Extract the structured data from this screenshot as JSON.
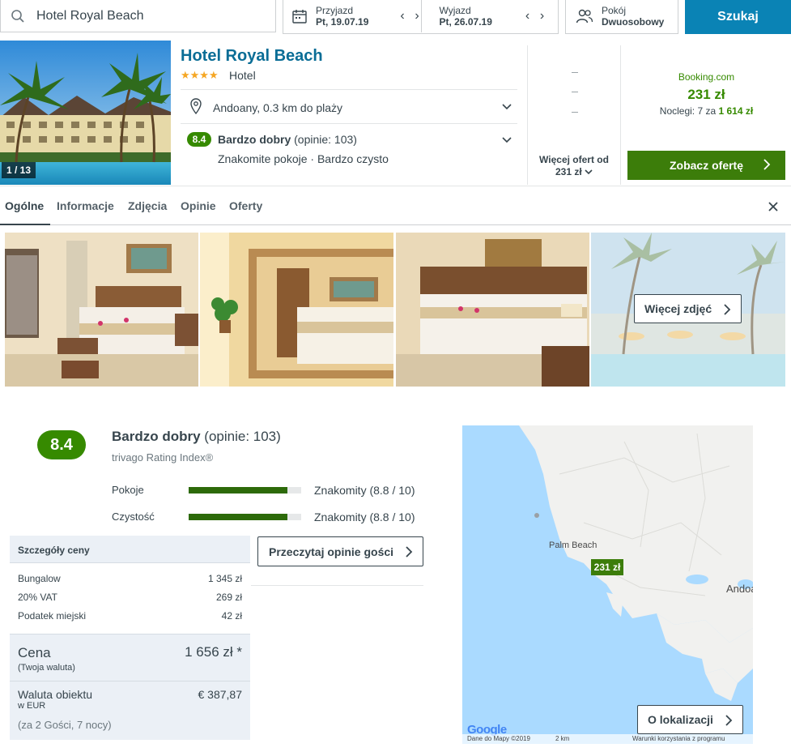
{
  "search": {
    "query": "Hotel Royal Beach"
  },
  "dates": {
    "checkin_label": "Przyjazd",
    "checkin_value": "Pt, 19.07.19",
    "checkout_label": "Wyjazd",
    "checkout_value": "Pt, 26.07.19"
  },
  "room": {
    "label": "Pokój",
    "value": "Dwuosobowy"
  },
  "search_button": "Szukaj",
  "hotel": {
    "name": "Hotel Royal Beach",
    "stars": "★★★★",
    "star_count": 4,
    "type": "Hotel",
    "photo_counter": "1 / 13",
    "location": "Andoany, 0.3 km do plaży",
    "rating": "8.4",
    "rating_label": "Bardzo dobry",
    "rating_count": "(opinie: 103)",
    "highlights": "Znakomite pokoje · Bardzo czysto"
  },
  "offers": {
    "more_offers_line1": "Więcej ofert od",
    "more_offers_line2": "231 zł",
    "provider": "Booking.com",
    "price": "231 zł",
    "nights_text": "Noclegi: 7 za",
    "nights_total": "1 614 zł",
    "cta": "Zobacz ofertę"
  },
  "tabs": [
    "Ogólne",
    "Informacje",
    "Zdjęcia",
    "Opinie",
    "Oferty"
  ],
  "gallery": {
    "more_photos": "Więcej zdjęć"
  },
  "rating_panel": {
    "score": "8.4",
    "label": "Bardzo dobry",
    "count": "(opinie: 103)",
    "index": "trivago Rating Index®",
    "metrics": [
      {
        "name": "Pokoje",
        "value": "Znakomity (8.8 / 10)",
        "score": 8.8
      },
      {
        "name": "Czystość",
        "value": "Znakomity (8.8 / 10)",
        "score": 8.8
      }
    ],
    "read_reviews": "Przeczytaj opinie gości"
  },
  "price_details": {
    "header": "Szczegóły ceny",
    "rows": [
      {
        "label": "Bungalow",
        "value": "1 345 zł"
      },
      {
        "label": "20% VAT",
        "value": "269 zł"
      },
      {
        "label": "Podatek miejski",
        "value": "42 zł"
      }
    ],
    "total_label": "Cena",
    "total_value": "1 656 zł *",
    "total_note": "(Twoja waluta)",
    "property_currency_label": "Waluta obiektu",
    "property_currency_value": "€ 387,87",
    "property_currency_note": "w EUR",
    "guests_note": "(za 2 Gości, 7 nocy)"
  },
  "map": {
    "place_1": "Palm Beach",
    "place_2": "Andoa",
    "pin_price": "231 zł",
    "logo": "Google",
    "attribution": "Dane do Mapy ©2019",
    "scale": "2 km",
    "terms": "Warunki korzystania z programu",
    "location_button": "O lokalizacji"
  },
  "colors": {
    "accent": "#0a83b5",
    "green": "#368a00",
    "dark_green": "#3c7d0a",
    "hotel_name": "#0a6d96"
  }
}
